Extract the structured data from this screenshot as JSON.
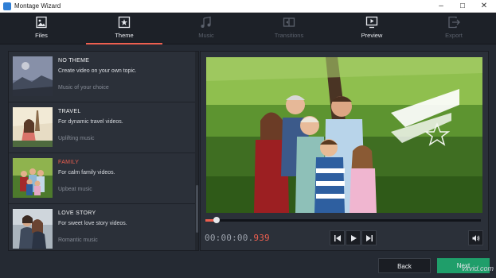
{
  "window": {
    "title": "Montage Wizard",
    "minimize": "–",
    "maximize": "☐",
    "close": "✕"
  },
  "tabs": [
    {
      "label": "Files",
      "icon": "files-icon",
      "state": "enabled"
    },
    {
      "label": "Theme",
      "icon": "theme-icon",
      "state": "active"
    },
    {
      "label": "Music",
      "icon": "music-icon",
      "state": "disabled"
    },
    {
      "label": "Transitions",
      "icon": "transitions-icon",
      "state": "disabled"
    },
    {
      "label": "Preview",
      "icon": "preview-icon",
      "state": "enabled"
    },
    {
      "label": "Export",
      "icon": "export-icon",
      "state": "disabled"
    }
  ],
  "themes": [
    {
      "name": "NO THEME",
      "description": "Create video on your own topic.",
      "music": "Music of your choice",
      "selected": false
    },
    {
      "name": "TRAVEL",
      "description": "For dynamic travel videos.",
      "music": "Uplifting music",
      "selected": false
    },
    {
      "name": "FAMILY",
      "description": "For calm family videos.",
      "music": "Upbeat music",
      "selected": true
    },
    {
      "name": "LOVE STORY",
      "description": "For sweet love story videos.",
      "music": "Romantic music",
      "selected": false
    }
  ],
  "player": {
    "timecode_main": "00:00:00.",
    "timecode_ms": "939",
    "progress": 0.04
  },
  "buttons": {
    "back": "Back",
    "next": "Next"
  },
  "watermark": "vxvid.com",
  "colors": {
    "accent": "#ee5f4f",
    "next": "#1f9e6a",
    "background": "#252a33"
  }
}
